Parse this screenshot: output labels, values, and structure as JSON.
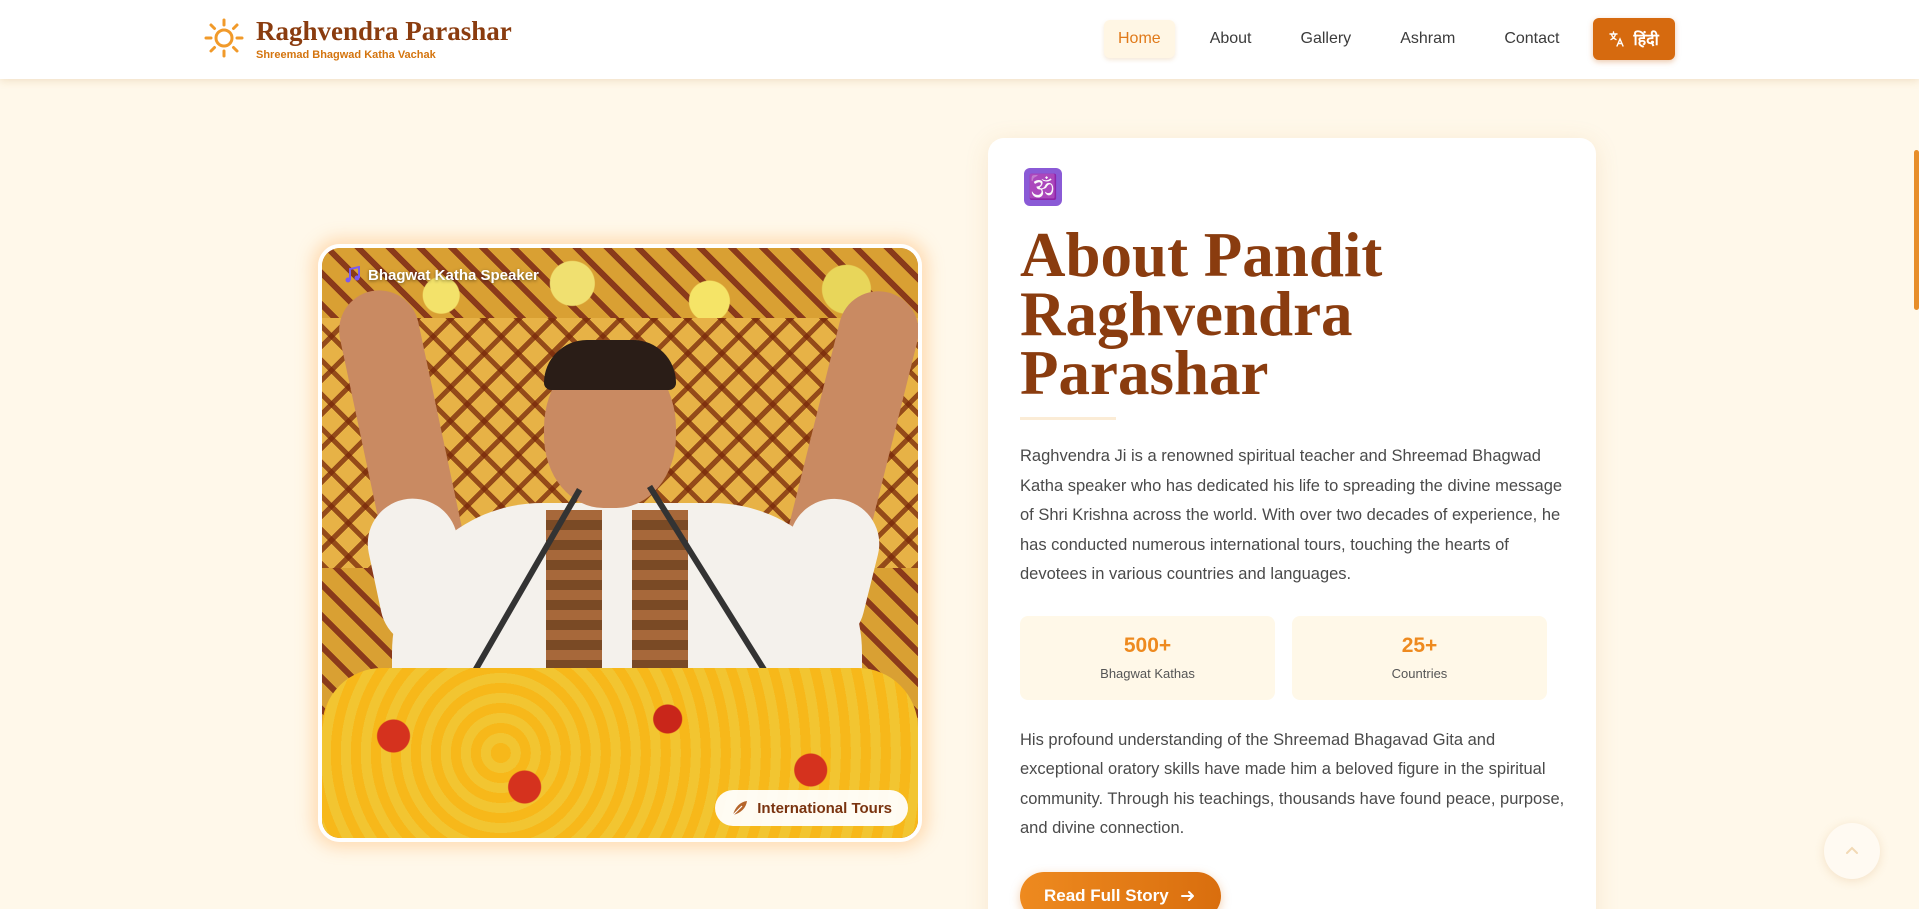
{
  "header": {
    "brand_title": "Raghvendra Parashar",
    "brand_subtitle": "Shreemad Bhagwad Katha Vachak",
    "nav": [
      {
        "label": "Home",
        "active": true
      },
      {
        "label": "About",
        "active": false
      },
      {
        "label": "Gallery",
        "active": false
      },
      {
        "label": "Ashram",
        "active": false
      },
      {
        "label": "Contact",
        "active": false
      }
    ],
    "lang_button": "हिंदी"
  },
  "photo": {
    "badge_top": "Bhagwat Katha Speaker",
    "badge_bottom": "International Tours"
  },
  "about": {
    "icon": "🕉️",
    "title": "About Pandit Raghvendra Parashar",
    "paragraph1": "Raghvendra Ji is a renowned spiritual teacher and Shreemad Bhagwad Katha speaker who has dedicated his life to spreading the divine message of Shri Krishna across the world. With over two decades of experience, he has conducted numerous international tours, touching the hearts of devotees in various countries and languages.",
    "stats": [
      {
        "value": "500+",
        "label": "Bhagwat Kathas"
      },
      {
        "value": "25+",
        "label": "Countries"
      }
    ],
    "paragraph2": "His profound understanding of the Shreemad Bhagavad Gita and exceptional oratory skills have made him a beloved figure in the spiritual community. Through his teachings, thousands have found peace, purpose, and divine connection.",
    "cta": "Read Full Story"
  },
  "colors": {
    "brand": "#8a3c0f",
    "accent": "#ee8a1f",
    "background": "#fff8ea"
  }
}
